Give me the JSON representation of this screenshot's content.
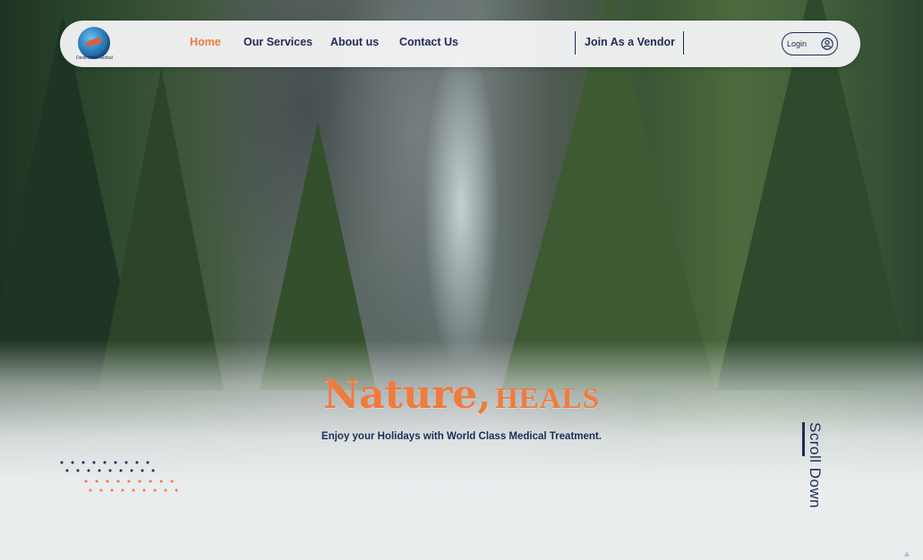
{
  "nav": {
    "logo_text": "Destination Global",
    "links": [
      {
        "label": "Home",
        "active": true
      },
      {
        "label": "Our Services",
        "active": false
      },
      {
        "label": "About us",
        "active": false
      },
      {
        "label": "Contact Us",
        "active": false
      }
    ],
    "vendor_label": "Join As a Vendor",
    "login_label": "Login",
    "login_icon": "user-circle-icon"
  },
  "hero": {
    "title_part1": "Nature,",
    "title_part2": "HEALS",
    "subtitle": "Enjoy your Holidays with World Class Medical Treatment."
  },
  "scroll": {
    "label": "Scroll Down"
  },
  "colors": {
    "accent": "#f07b3f",
    "navy": "#1c2d5a",
    "background": "#e9edee"
  }
}
